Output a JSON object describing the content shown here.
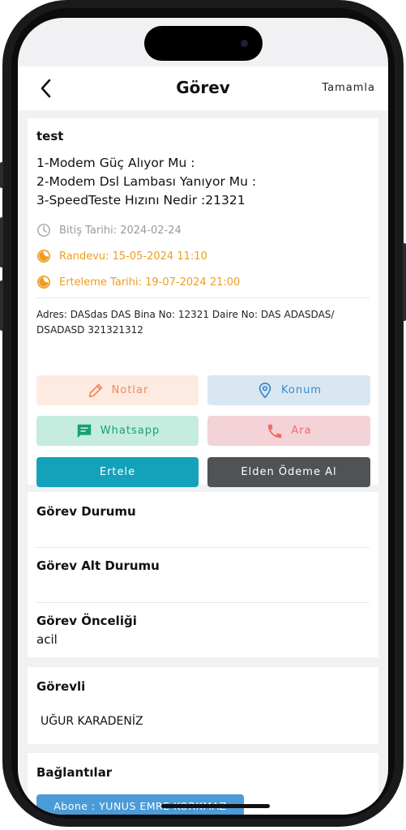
{
  "nav": {
    "title": "Görev",
    "done_label": "Tamamla"
  },
  "task": {
    "title": "test",
    "description_lines": [
      "1-Modem Güç Alıyor Mu :",
      "2-Modem Dsl Lambası Yanıyor Mu :",
      "3-SpeedTeste Hızını Nedir :21321"
    ],
    "end_date": "Bitiş Tarihi: 2024-02-24",
    "appointment": "Randevu: 15-05-2024 11:10",
    "postpone_date": "Erteleme Tarihi: 19-07-2024 21:00",
    "address": "Adres: DASdas DAS Bina No: 12321 Daire No: DAS ADASDAS/ DSADASD 321321312"
  },
  "actions": {
    "notes": "Notlar",
    "location": "Konum",
    "whatsapp": "Whatsapp",
    "call": "Ara",
    "postpone": "Ertele",
    "cash_payment": "Elden Ödeme Al"
  },
  "status": {
    "status_label": "Görev Durumu",
    "status_value": "",
    "sub_status_label": "Görev Alt Durumu",
    "sub_status_value": "",
    "priority_label": "Görev Önceliği",
    "priority_value": "acil"
  },
  "assignee": {
    "label": "Görevli",
    "name": "UĞUR KARADENİZ"
  },
  "connections": {
    "label": "Bağlantılar",
    "subscriber_chip": "Abone : YUNUS EMRE KORKMAZ"
  },
  "colors": {
    "orange": "#f09c1e",
    "grey_text": "#9a9a9a",
    "notes_bg": "#fdeae0",
    "location_bg": "#d9e7f3",
    "whatsapp_bg": "#c6ebdf",
    "call_bg": "#f3d3d8",
    "postpone_bg": "#14a2ba",
    "cash_bg": "#4f5355",
    "chip_bg": "#4b9bd6"
  },
  "icons": [
    "chevron-left-icon",
    "clock-icon",
    "half-moon-icon",
    "pencil-icon",
    "location-pin-icon",
    "message-icon",
    "phone-icon"
  ]
}
